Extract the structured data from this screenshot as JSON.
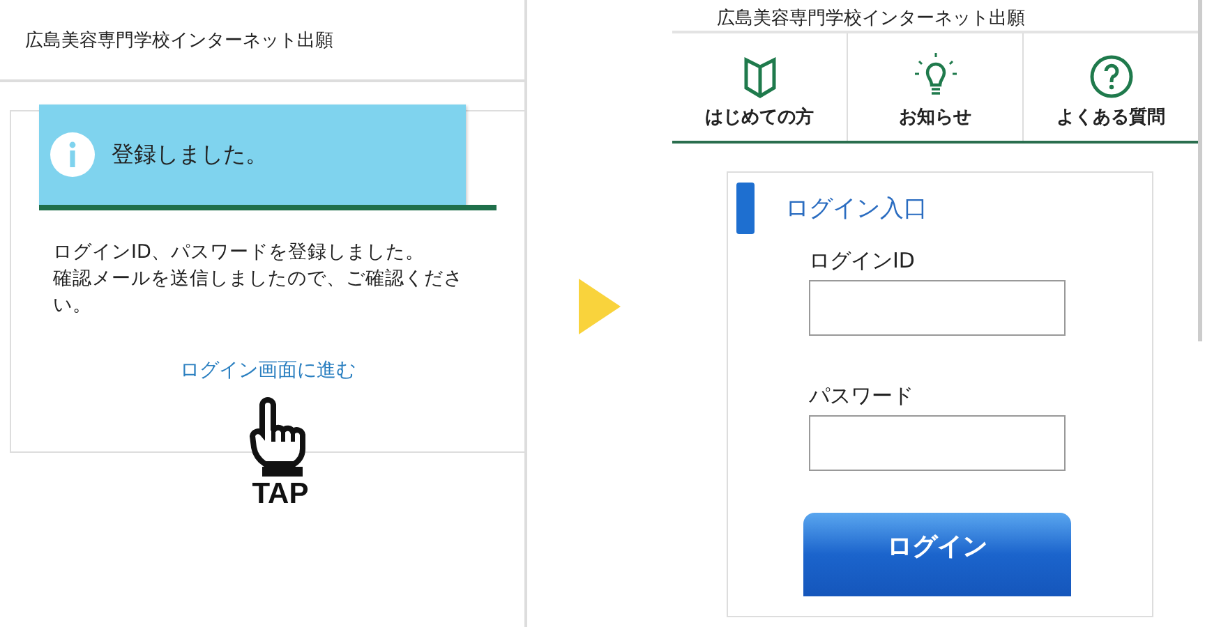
{
  "before": {
    "title": "広島美容専門学校インターネット出願",
    "toast": {
      "message": "登録しました。"
    },
    "message_lines": [
      "ログインID、パスワードを登録しました。",
      "確認メールを送信しましたので、ご確認ください。"
    ],
    "link": "ログイン画面に進む",
    "tap_label": "TAP"
  },
  "after": {
    "title": "広島美容専門学校インターネット出願",
    "nav": [
      {
        "kind": "book",
        "label": "はじめての方"
      },
      {
        "kind": "bulb",
        "label": "お知らせ"
      },
      {
        "kind": "question",
        "label": "よくある質問"
      }
    ],
    "login": {
      "title": "ログイン入口",
      "fields": [
        {
          "label": "ログインID"
        },
        {
          "label": "パスワード"
        }
      ],
      "button": "ログイン"
    }
  }
}
